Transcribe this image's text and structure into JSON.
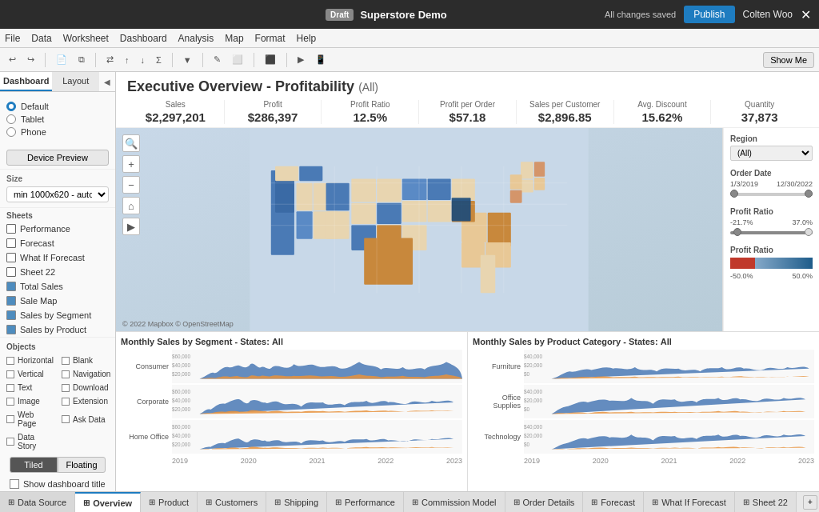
{
  "topbar": {
    "draft_label": "Draft",
    "title": "Superstore Demo",
    "save_status": "All changes saved",
    "publish_label": "Publish",
    "user_name": "Colten Woo",
    "close_label": "✕"
  },
  "menubar": {
    "items": [
      "File",
      "Data",
      "Worksheet",
      "Dashboard",
      "Analysis",
      "Map",
      "Format",
      "Help"
    ]
  },
  "toolbar": {
    "show_me_label": "Show Me"
  },
  "sidebar": {
    "tabs": [
      "Dashboard",
      "Layout"
    ],
    "devices": [
      {
        "label": "Default",
        "selected": true
      },
      {
        "label": "Tablet",
        "selected": false
      },
      {
        "label": "Phone",
        "selected": false
      }
    ],
    "device_preview_label": "Device Preview",
    "size_label": "Size",
    "size_value": "min 1000x620 - auto",
    "sheets_label": "Sheets",
    "sheets": [
      {
        "label": "Performance",
        "type": "worksheet"
      },
      {
        "label": "Forecast",
        "type": "worksheet"
      },
      {
        "label": "What If Forecast",
        "type": "worksheet"
      },
      {
        "label": "Sheet 22",
        "type": "worksheet"
      },
      {
        "label": "Total Sales",
        "type": "worksheet"
      },
      {
        "label": "Sale Map",
        "type": "worksheet"
      },
      {
        "label": "Sales by Segment",
        "type": "worksheet"
      },
      {
        "label": "Sales by Product",
        "type": "worksheet"
      }
    ],
    "objects_label": "Objects",
    "objects": [
      {
        "label": "Horizontal",
        "type": "h"
      },
      {
        "label": "Blank",
        "type": "blank"
      },
      {
        "label": "Vertical",
        "type": "v"
      },
      {
        "label": "Navigation",
        "type": "nav"
      },
      {
        "label": "Text",
        "type": "text"
      },
      {
        "label": "Download",
        "type": "dl"
      },
      {
        "label": "Image",
        "type": "img"
      },
      {
        "label": "Extension",
        "type": "ext"
      },
      {
        "label": "Web Page",
        "type": "web"
      },
      {
        "label": "Ask Data",
        "type": "ask"
      },
      {
        "label": "Data Story",
        "type": "story"
      }
    ],
    "tiled_label": "Tiled",
    "floating_label": "Floating",
    "show_dashboard_title_label": "Show dashboard title"
  },
  "dashboard": {
    "title": "Executive Overview - Profitability",
    "title_tag": "(All)",
    "metrics": [
      {
        "label": "Sales",
        "value": "$2,297,201"
      },
      {
        "label": "Profit",
        "value": "$286,397"
      },
      {
        "label": "Profit Ratio",
        "value": "12.5%"
      },
      {
        "label": "Profit per Order",
        "value": "$57.18"
      },
      {
        "label": "Sales per Customer",
        "value": "$2,896.85"
      },
      {
        "label": "Avg. Discount",
        "value": "15.62%"
      },
      {
        "label": "Quantity",
        "value": "37,873"
      }
    ]
  },
  "filters": {
    "region_label": "Region",
    "region_value": "(All)",
    "order_date_label": "Order Date",
    "order_date_start": "1/3/2019",
    "order_date_end": "12/30/2022",
    "profit_ratio_label": "Profit Ratio",
    "profit_ratio_min": "-21.7%",
    "profit_ratio_max": "37.0%",
    "profit_ratio2_label": "Profit Ratio",
    "profit_ratio2_min": "-50.0%",
    "profit_ratio2_max": "50.0%"
  },
  "left_charts": {
    "title": "Monthly Sales by Segment - States: All",
    "segments": [
      "Consumer",
      "Corporate",
      "Home Office"
    ],
    "y_labels": [
      "$60,000",
      "$40,000",
      "$20,000"
    ],
    "x_labels": [
      "2019",
      "2020",
      "2021",
      "2022",
      "2023"
    ]
  },
  "right_charts": {
    "title": "Monthly Sales by Product Category - States: All",
    "categories": [
      "Furniture",
      "Office Supplies",
      "Technology"
    ],
    "y_labels": [
      "$40,000",
      "$20,000",
      "$0"
    ],
    "x_labels": [
      "2019",
      "2020",
      "2021",
      "2022",
      "2023"
    ]
  },
  "map": {
    "copyright": "© 2022 Mapbox © OpenStreetMap"
  },
  "bottom_tabs": {
    "data_source_label": "Data Source",
    "tabs": [
      {
        "label": "Overview",
        "type": "dashboard",
        "active": true
      },
      {
        "label": "Product",
        "type": "worksheet"
      },
      {
        "label": "Customers",
        "type": "worksheet"
      },
      {
        "label": "Shipping",
        "type": "worksheet"
      },
      {
        "label": "Performance",
        "type": "worksheet"
      },
      {
        "label": "Commission Model",
        "type": "worksheet"
      },
      {
        "label": "Order Details",
        "type": "worksheet"
      },
      {
        "label": "Forecast",
        "type": "worksheet"
      },
      {
        "label": "What If Forecast",
        "type": "worksheet"
      },
      {
        "label": "Sheet 22",
        "type": "worksheet"
      }
    ]
  }
}
